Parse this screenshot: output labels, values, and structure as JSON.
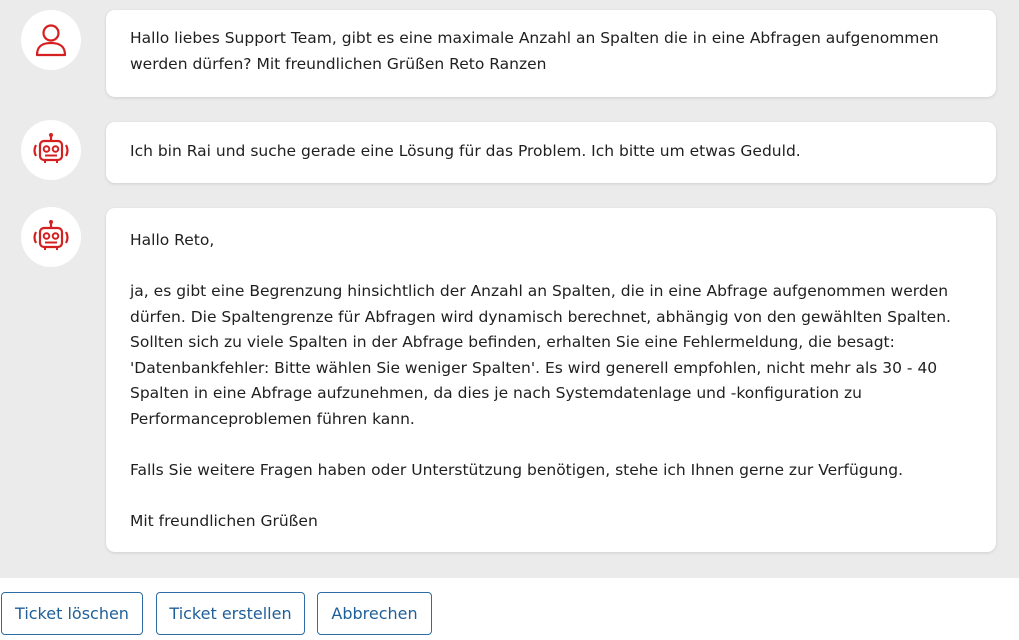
{
  "colors": {
    "accent": "#d42020",
    "button_text": "#1f5f99",
    "button_border": "#2e6da4",
    "background": "#ebebeb"
  },
  "messages": [
    {
      "sender": "user",
      "icon": "user-icon",
      "paragraphs": [
        "Hallo liebes Support Team, gibt es eine maximale Anzahl an Spalten die in eine Abfragen aufgenommen\nwerden dürfen? Mit freundlichen Grüßen Reto Ranzen"
      ]
    },
    {
      "sender": "bot",
      "icon": "robot-icon",
      "paragraphs": [
        "Ich bin Rai und suche gerade eine Lösung für das Problem. Ich bitte um etwas Geduld."
      ]
    },
    {
      "sender": "bot",
      "icon": "robot-icon",
      "paragraphs": [
        "Hallo Reto,",
        "ja, es gibt eine Begrenzung hinsichtlich der Anzahl an Spalten, die in eine Abfrage aufgenommen werden\ndürfen. Die Spaltengrenze für Abfragen wird dynamisch berechnet, abhängig von den gewählten Spalten.\nSollten sich zu viele Spalten in der Abfrage befinden, erhalten Sie eine Fehlermeldung, die besagt:\n'Datenbankfehler: Bitte wählen Sie weniger Spalten'. Es wird generell empfohlen, nicht mehr als 30 - 40\nSpalten in eine Abfrage aufzunehmen, da dies je nach Systemdatenlage und -konfiguration zu\nPerformanceproblemen führen kann.",
        "Falls Sie weitere Fragen haben oder Unterstützung benötigen, stehe ich Ihnen gerne zur Verfügung.",
        "Mit freundlichen Grüßen"
      ]
    }
  ],
  "footer": {
    "delete_label": "Ticket löschen",
    "create_label": "Ticket erstellen",
    "cancel_label": "Abbrechen"
  }
}
